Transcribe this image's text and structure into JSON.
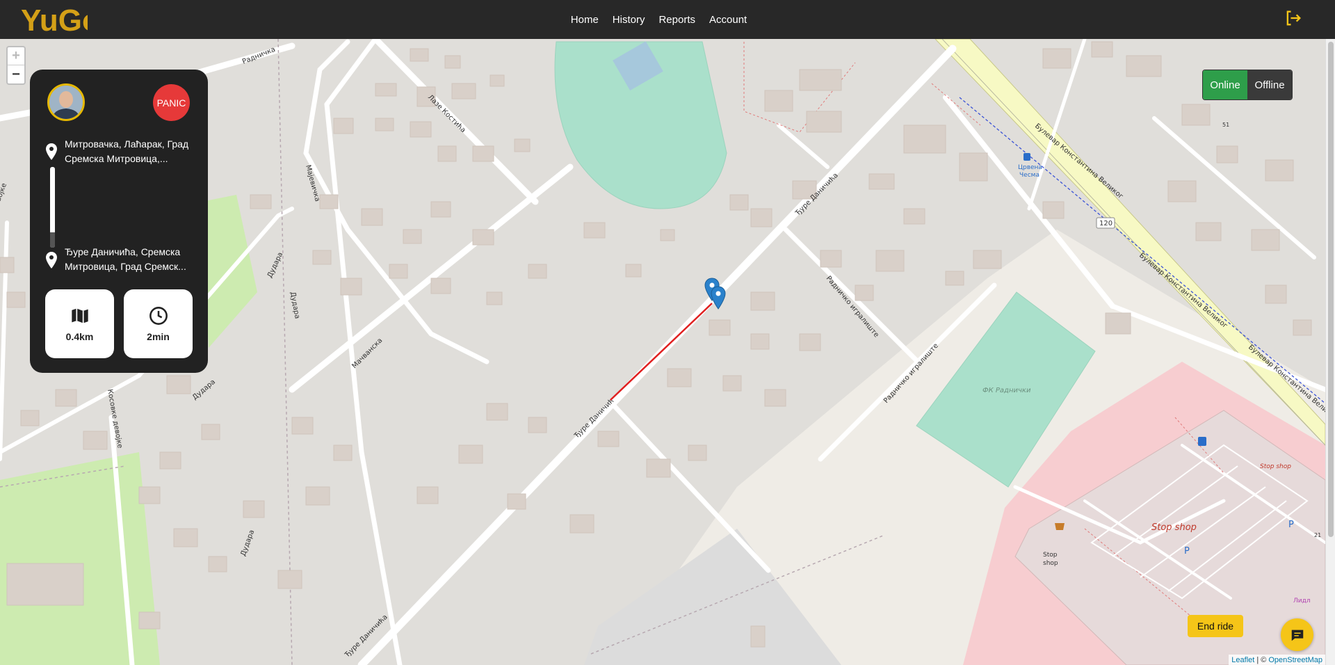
{
  "nav": {
    "logo_text": "YuGo",
    "links": [
      "Home",
      "History",
      "Reports",
      "Account"
    ]
  },
  "map": {
    "zoom_in": "+",
    "zoom_out": "−",
    "street_labels": {
      "radnichka_top": "Радничка",
      "laze_kostica": "Лазе Костића",
      "majevichka": "Мајевичка",
      "dudara_1": "Дудара",
      "dudara_2": "Дудара",
      "dudara_3": "Дудара",
      "dudara_4": "Дудара",
      "dudara_5": "Дудара",
      "macvanska": "Мачванска",
      "kosovke": "Косовке девојке",
      "djure_1": "Ђуре Даничића",
      "djure_2": "Ђуре Даничић",
      "djure_3": "Ђуре Даничића",
      "radnicko_1": "Радничко игралиште",
      "radnicko_2": "Радничко игралиште",
      "bulevar_1": "Булевар Константина Великог",
      "bulevar_2": "Булевар Константина Великог",
      "bulevar_3": "Булевар Константина Великог",
      "fk": "ФК Раднички",
      "stop_shop_big": "Stop shop",
      "stop_shop_small": "Stop shop",
      "stop_shop_poi_1": "Stop",
      "stop_shop_poi_2": "shop",
      "bus_stop_1": "Црвена",
      "bus_stop_2": "Чесма",
      "lidl": "Лидл",
      "route_num": "120",
      "house_51": "51",
      "house_21": "21",
      "parking": "P",
      "left_edge": "војке"
    },
    "route_color": "#e02020",
    "marker_color": "#2a81cb"
  },
  "ride": {
    "panic_label": "PANIC",
    "from_line1": "Митровачка, Лаћарак, Град",
    "from_line2": "Сремска Митровица,...",
    "to_line1": "Ђуре Даничића, Сремска",
    "to_line2": "Митровица, Град Сремск...",
    "progress": 0.81,
    "distance": "0.4km",
    "duration": "2min"
  },
  "status": {
    "online_label": "Online",
    "offline_label": "Offline",
    "current": "Online"
  },
  "actions": {
    "end_ride_label": "End ride"
  },
  "attribution": {
    "leaflet": "Leaflet",
    "sep": "| ©",
    "osm": "OpenStreetMap"
  },
  "colors": {
    "navbar": "#282828",
    "accent_yellow": "#f5c518",
    "online_green": "#2e9e4a",
    "panic_red": "#e63939"
  }
}
